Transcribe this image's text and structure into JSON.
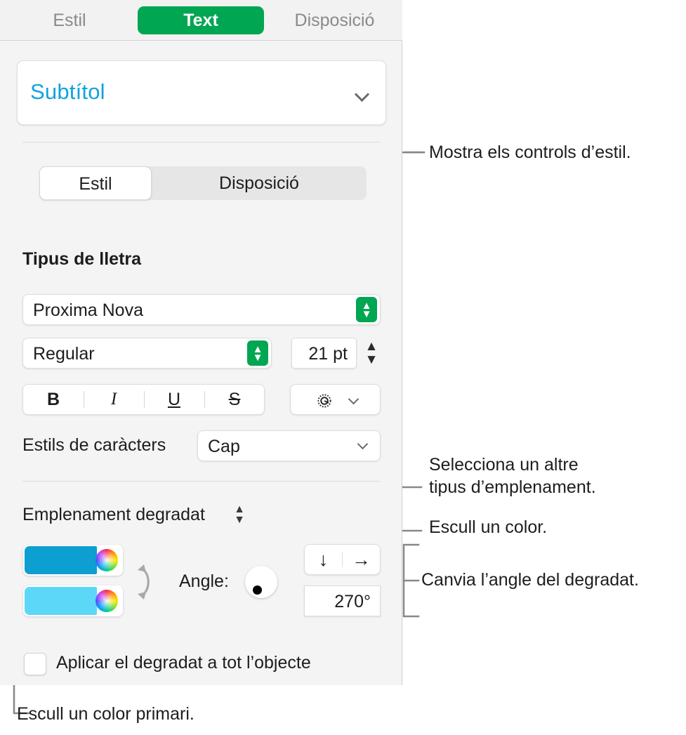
{
  "app": {
    "panel_name": "format-inspector",
    "accent_green": "#00a651",
    "accent_blue": "#0fa3dd"
  },
  "toolbar_tabs": [
    {
      "label": "Estil",
      "selected": false
    },
    {
      "label": "Text",
      "selected": true
    },
    {
      "label": "Disposició",
      "selected": false
    }
  ],
  "paragraph_style": {
    "value": "Subtítol",
    "chevron": "chevron-down-icon"
  },
  "segmented_control": [
    {
      "label": "Estil",
      "selected": true
    },
    {
      "label": "Disposició",
      "selected": false
    }
  ],
  "font_section": {
    "heading": "Tipus de lletra",
    "family": "Proxima Nova",
    "style": "Regular",
    "size": "21 pt",
    "stepper_up": "▲",
    "stepper_down": "▼",
    "popup_up": "▲",
    "popup_down": "▼",
    "format_buttons": [
      {
        "name": "bold",
        "label": "B"
      },
      {
        "name": "italic",
        "label": "I"
      },
      {
        "name": "underline",
        "label": "U"
      },
      {
        "name": "strikethrough",
        "label": "S"
      }
    ],
    "options_button": {
      "icon": "gear-icon",
      "chevron": "chevron-down-icon"
    }
  },
  "character_styles": {
    "label": "Estils de caràcters",
    "value": "Cap",
    "chevron": "chevron-down-icon"
  },
  "fill_section": {
    "kind_label": "Emplenament degradat",
    "stepper_up": "▲",
    "stepper_down": "▼",
    "color_start": "#0d9fd0",
    "color_end": "#5cd7f8",
    "swap_icon": "swap-arrows-icon",
    "angle_label": "Angle:",
    "angle_value": "270°",
    "direction_down": "↓",
    "direction_right": "→",
    "apply_checkbox_label": "Aplicar el degradat a tot l’objecte",
    "apply_checkbox_checked": false
  },
  "callouts": [
    {
      "id": "show-style-controls",
      "text": "Mostra els controls d’estil."
    },
    {
      "id": "select-fill-type-line1",
      "text": "Selecciona un altre"
    },
    {
      "id": "select-fill-type-line2",
      "text": "tipus d’emplenament."
    },
    {
      "id": "choose-a-color",
      "text": "Escull un color."
    },
    {
      "id": "change-gradient-angle",
      "text": "Canvia l’angle del degradat."
    },
    {
      "id": "choose-primary-color",
      "text": "Escull un color primari."
    }
  ]
}
